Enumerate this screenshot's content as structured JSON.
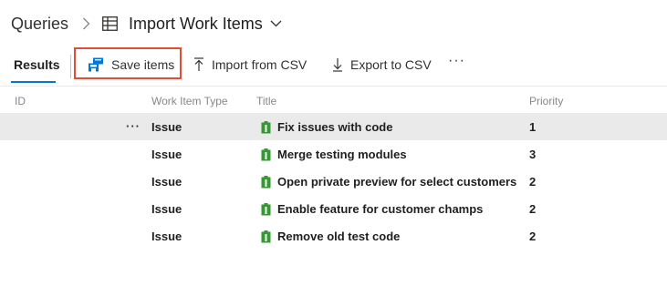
{
  "breadcrumb": {
    "root": "Queries",
    "separator_icon": "chevron-right-icon",
    "title_icon": "table-query-icon",
    "title": "Import Work Items",
    "dropdown_icon": "chevron-down-icon"
  },
  "tabs": [
    {
      "label": "Results",
      "selected": true
    }
  ],
  "toolbar": {
    "save_items": {
      "label": "Save items",
      "icon": "save-items-icon",
      "highlighted": true,
      "highlight_color": "#e14e36"
    },
    "import_csv": {
      "label": "Import from CSV",
      "icon": "upload-arrow-icon"
    },
    "export_csv": {
      "label": "Export to CSV",
      "icon": "download-arrow-icon"
    },
    "more": "···"
  },
  "columns": {
    "id": "ID",
    "type": "Work Item Type",
    "title": "Title",
    "priority": "Priority"
  },
  "rows": [
    {
      "more": "···",
      "type": "Issue",
      "title": "Fix issues with code",
      "priority": "1",
      "selected": true
    },
    {
      "type": "Issue",
      "title": "Merge testing modules",
      "priority": "3"
    },
    {
      "type": "Issue",
      "title": "Open private preview for select customers",
      "priority": "2"
    },
    {
      "type": "Issue",
      "title": "Enable feature for customer champs",
      "priority": "2"
    },
    {
      "type": "Issue",
      "title": "Remove old test code",
      "priority": "2"
    }
  ],
  "colors": {
    "accent": "#0078d4",
    "issue_icon": "#339933",
    "selected_row": "#eaeaea"
  }
}
